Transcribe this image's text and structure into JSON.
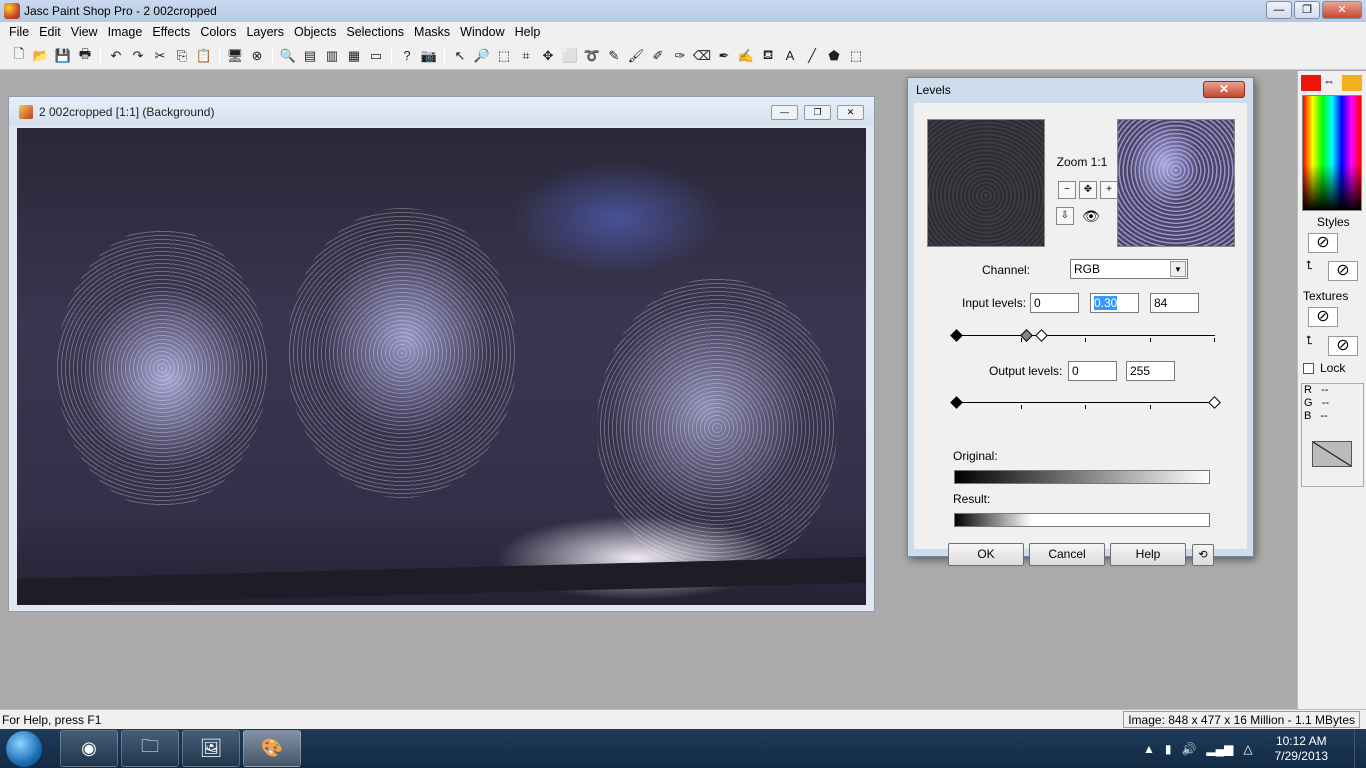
{
  "app": {
    "title": "Jasc Paint Shop Pro - 2 002cropped",
    "window_buttons": {
      "minimize": "—",
      "maximize": "❐",
      "close": "✕"
    }
  },
  "menu": [
    "File",
    "Edit",
    "View",
    "Image",
    "Effects",
    "Colors",
    "Layers",
    "Objects",
    "Selections",
    "Masks",
    "Window",
    "Help"
  ],
  "toolbar": {
    "icons": [
      "new-icon",
      "open-icon",
      "save-icon",
      "print-icon",
      "sep",
      "undo-icon",
      "redo-icon",
      "cut-icon",
      "copy-icon",
      "paste-icon",
      "sep",
      "browse-icon",
      "close-doc-icon",
      "sep",
      "zoom-icon",
      "histogram-icon",
      "palette-icon",
      "layer-icon",
      "window-icon",
      "sep",
      "help-icon",
      "screenshot-icon",
      "sep",
      "arrow-tool-icon",
      "zoom-tool-icon",
      "deform-icon",
      "crop-icon",
      "mover-icon",
      "select-icon",
      "freehand-icon",
      "dropper-icon",
      "brush-icon",
      "clone-icon",
      "scratch-icon",
      "eraser-icon",
      "picture-tube-icon",
      "airbrush-icon",
      "flood-fill-icon",
      "text-icon",
      "line-icon",
      "shape-icon",
      "object-selector-icon"
    ]
  },
  "image_window": {
    "title": "2 002cropped [1:1] (Background)"
  },
  "levels_dialog": {
    "title": "Levels",
    "close": "✕",
    "zoom_label": "Zoom 1:1",
    "channel_label": "Channel:",
    "channel_value": "RGB",
    "input_levels_label": "Input levels:",
    "input_low": "0",
    "input_gamma": "0.30",
    "input_high": "84",
    "output_levels_label": "Output levels:",
    "output_low": "0",
    "output_high": "255",
    "original_label": "Original:",
    "result_label": "Result:",
    "ok": "OK",
    "cancel": "Cancel",
    "help": "Help",
    "input_slider": {
      "low": 0,
      "gamma_pos": 0.27,
      "high_pos": 0.33
    },
    "output_slider": {
      "low": 0,
      "high": 1.0
    }
  },
  "palette": {
    "fg_color": "#e8180e",
    "bg_color": "#f2b01c",
    "styles_label": "Styles",
    "textures_label": "Textures",
    "lock_label": "Lock",
    "r_label": "R",
    "g_label": "G",
    "b_label": "B",
    "r_value": "--",
    "g_value": "--",
    "b_value": "--"
  },
  "status": {
    "help": "For Help, press F1",
    "info": "Image:  848 x 477 x 16 Million - 1.1 MBytes"
  },
  "taskbar": {
    "apps": [
      "chrome-icon",
      "explorer-icon",
      "pictures-icon",
      "paintshop-icon"
    ],
    "time": "10:12 AM",
    "date": "7/29/2013"
  }
}
